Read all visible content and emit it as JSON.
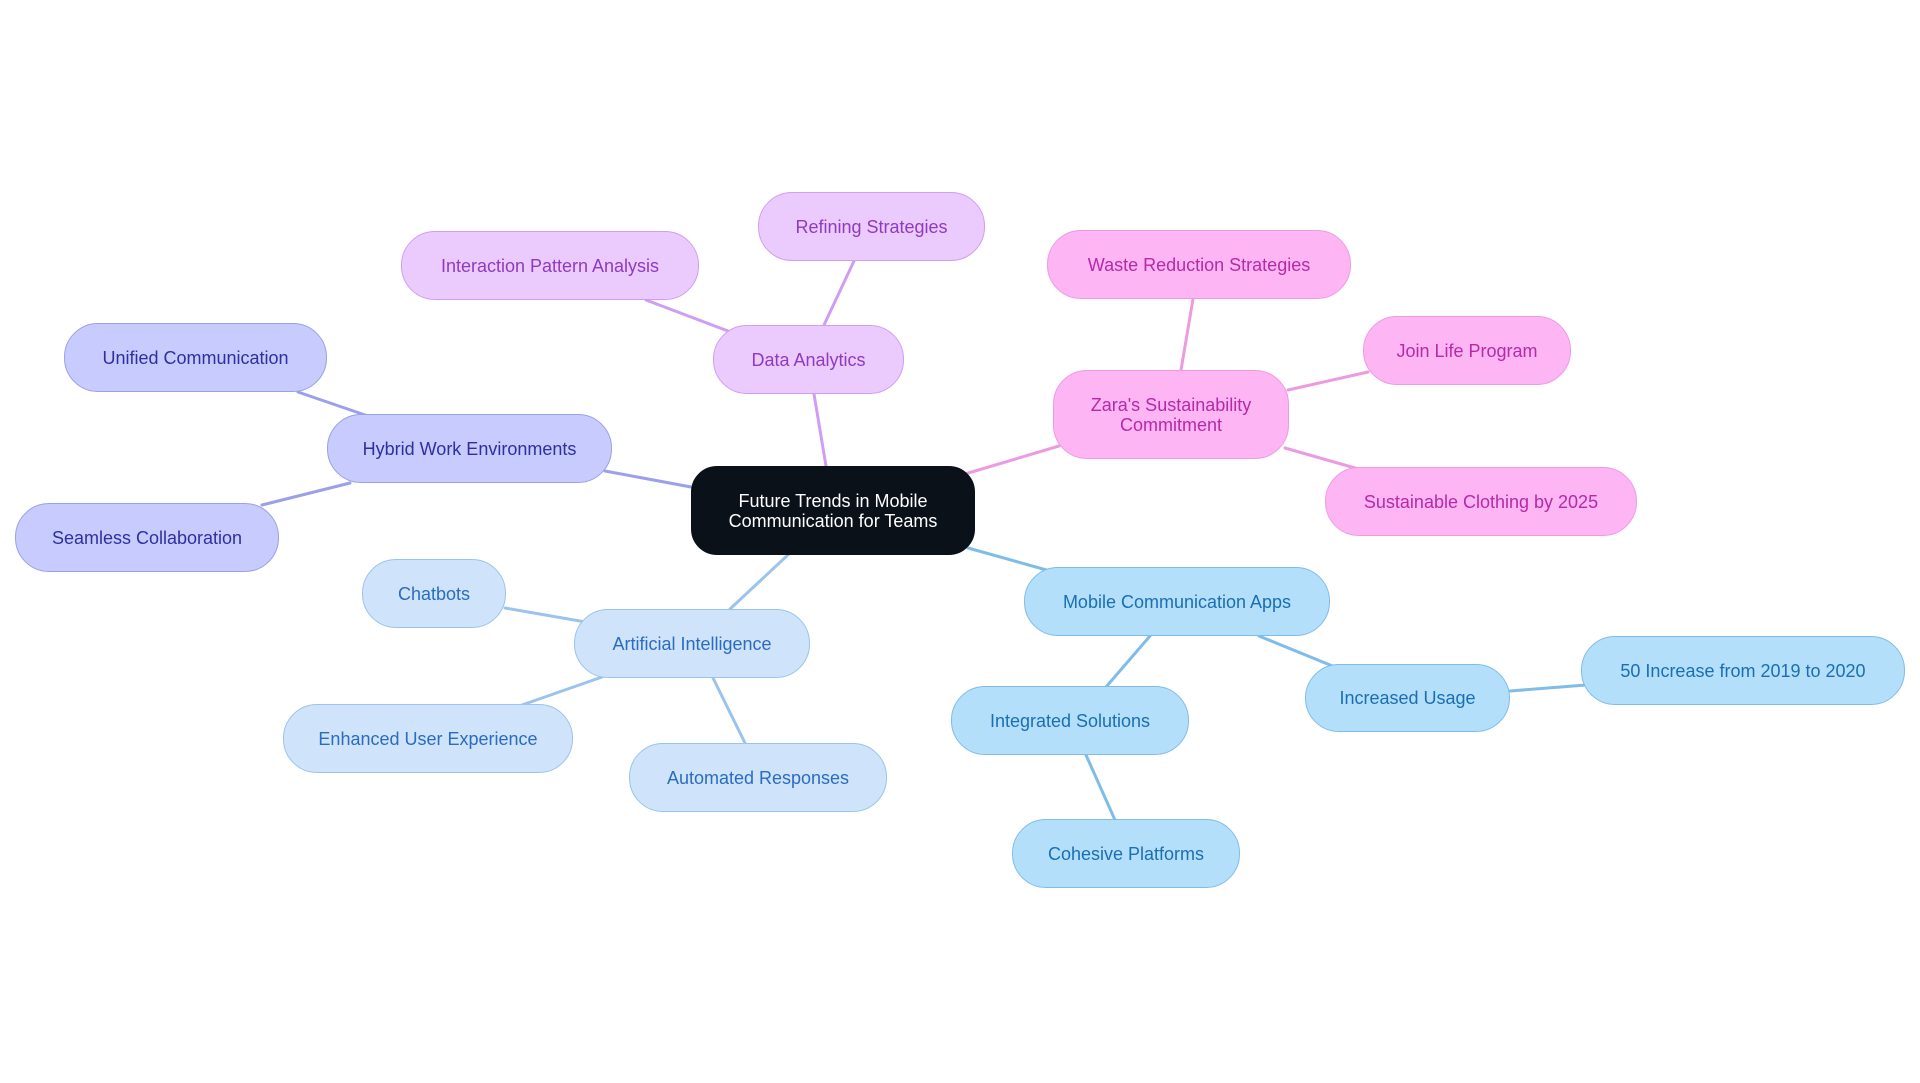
{
  "diagram": {
    "type": "mindmap",
    "root": {
      "id": "root",
      "label": "Future Trends in Mobile\nCommunication for Teams",
      "theme": "dark"
    },
    "themes": {
      "dark": {
        "fill": "#0b1119",
        "stroke": "#0b1119",
        "text": "#ffffff",
        "edge": "#0b1119"
      },
      "indigo": {
        "fill": "#c8cbfd",
        "stroke": "#9aa0ea",
        "text": "#2f2fa3",
        "edge": "#9aa0ea"
      },
      "purple": {
        "fill": "#ebcbfd",
        "stroke": "#cf9ef0",
        "text": "#8f3bbf",
        "edge": "#cf9ef0"
      },
      "pink": {
        "fill": "#fdb5f4",
        "stroke": "#ec9be0",
        "text": "#b62aa6",
        "edge": "#ec9be0"
      },
      "lightblue": {
        "fill": "#cfe4fb",
        "stroke": "#9bc3ec",
        "text": "#2a6cc0",
        "edge": "#9bc3ec"
      },
      "skyblue": {
        "fill": "#b4dffb",
        "stroke": "#7fbde8",
        "text": "#1a6fb3",
        "edge": "#7fbde8"
      }
    },
    "nodes": [
      {
        "id": "hybrid",
        "parent": "root",
        "label": "Hybrid Work Environments",
        "theme": "indigo"
      },
      {
        "id": "unified",
        "parent": "hybrid",
        "label": "Unified Communication",
        "theme": "indigo"
      },
      {
        "id": "seamless",
        "parent": "hybrid",
        "label": "Seamless Collaboration",
        "theme": "indigo"
      },
      {
        "id": "analytics",
        "parent": "root",
        "label": "Data Analytics",
        "theme": "purple"
      },
      {
        "id": "interaction",
        "parent": "analytics",
        "label": "Interaction Pattern Analysis",
        "theme": "purple"
      },
      {
        "id": "refining",
        "parent": "analytics",
        "label": "Refining Strategies",
        "theme": "purple"
      },
      {
        "id": "zara",
        "parent": "root",
        "label": "Zara's Sustainability\nCommitment",
        "theme": "pink"
      },
      {
        "id": "waste",
        "parent": "zara",
        "label": "Waste Reduction Strategies",
        "theme": "pink"
      },
      {
        "id": "joinlife",
        "parent": "zara",
        "label": "Join Life Program",
        "theme": "pink"
      },
      {
        "id": "sustainable",
        "parent": "zara",
        "label": "Sustainable Clothing by 2025",
        "theme": "pink"
      },
      {
        "id": "ai",
        "parent": "root",
        "label": "Artificial Intelligence",
        "theme": "lightblue"
      },
      {
        "id": "chatbots",
        "parent": "ai",
        "label": "Chatbots",
        "theme": "lightblue"
      },
      {
        "id": "ux",
        "parent": "ai",
        "label": "Enhanced User Experience",
        "theme": "lightblue"
      },
      {
        "id": "automated",
        "parent": "ai",
        "label": "Automated Responses",
        "theme": "lightblue"
      },
      {
        "id": "mobileapps",
        "parent": "root",
        "label": "Mobile Communication Apps",
        "theme": "skyblue"
      },
      {
        "id": "integrated",
        "parent": "mobileapps",
        "label": "Integrated Solutions",
        "theme": "skyblue"
      },
      {
        "id": "cohesive",
        "parent": "integrated",
        "label": "Cohesive Platforms",
        "theme": "skyblue"
      },
      {
        "id": "usage",
        "parent": "mobileapps",
        "label": "Increased Usage",
        "theme": "skyblue"
      },
      {
        "id": "increase50",
        "parent": "usage",
        "label": "50 Increase from 2019 to 2020",
        "theme": "skyblue"
      }
    ]
  }
}
